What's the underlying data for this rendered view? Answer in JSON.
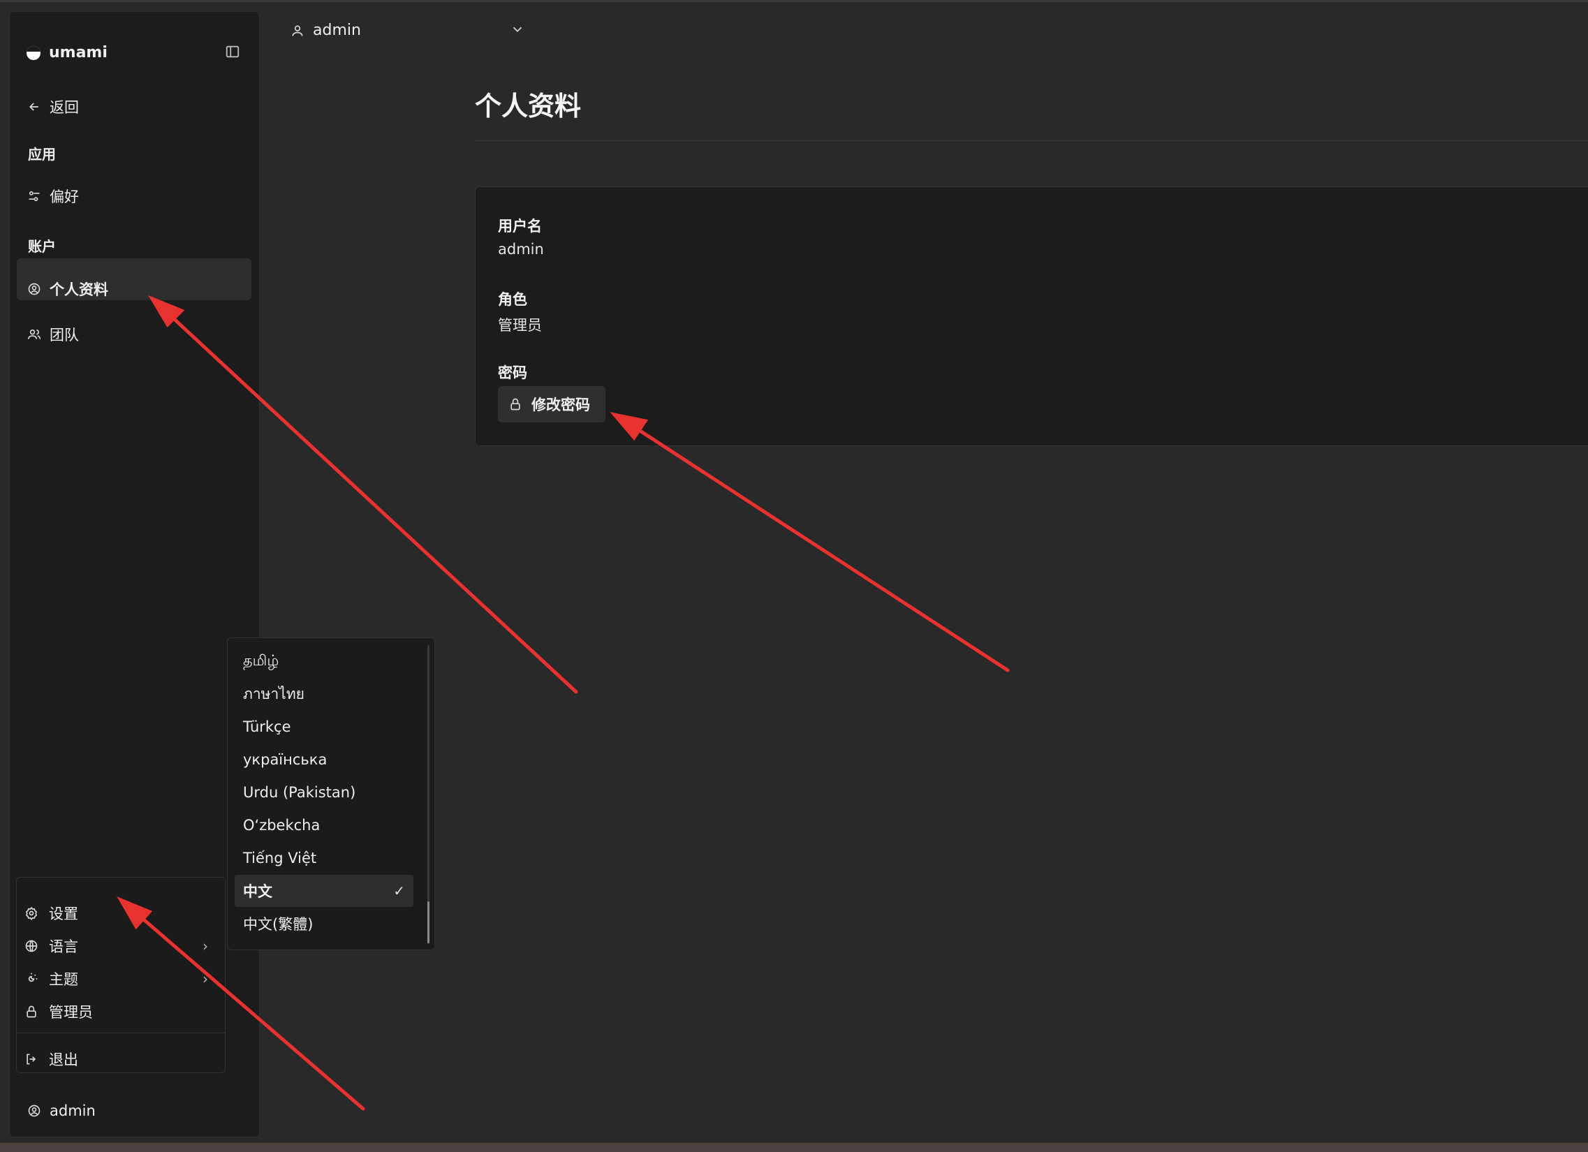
{
  "app": {
    "name": "umami"
  },
  "sidebar": {
    "back_label": "返回",
    "section_app": "应用",
    "preferences": "偏好",
    "section_account": "账户",
    "profile": "个人资料",
    "teams": "团队",
    "footer_user": "admin"
  },
  "user_menu": {
    "settings": "设置",
    "language": "语言",
    "theme": "主题",
    "admin": "管理员",
    "logout": "退出"
  },
  "language_menu": {
    "items": [
      "தமிழ்",
      "ภาษาไทย",
      "Türkçe",
      "українська",
      "Urdu (Pakistan)",
      "O‘zbekcha",
      "Tiếng Việt",
      "中文",
      "中文(繁體)"
    ],
    "selected": "中文"
  },
  "topbar": {
    "user": "admin"
  },
  "page": {
    "title": "个人资料"
  },
  "profile": {
    "username_label": "用户名",
    "username_value": "admin",
    "role_label": "角色",
    "role_value": "管理员",
    "password_label": "密码",
    "change_password": "修改密码"
  },
  "colors": {
    "annotation_arrow": "#e8322f",
    "background": "#292929",
    "panel": "#1c1c1c"
  }
}
